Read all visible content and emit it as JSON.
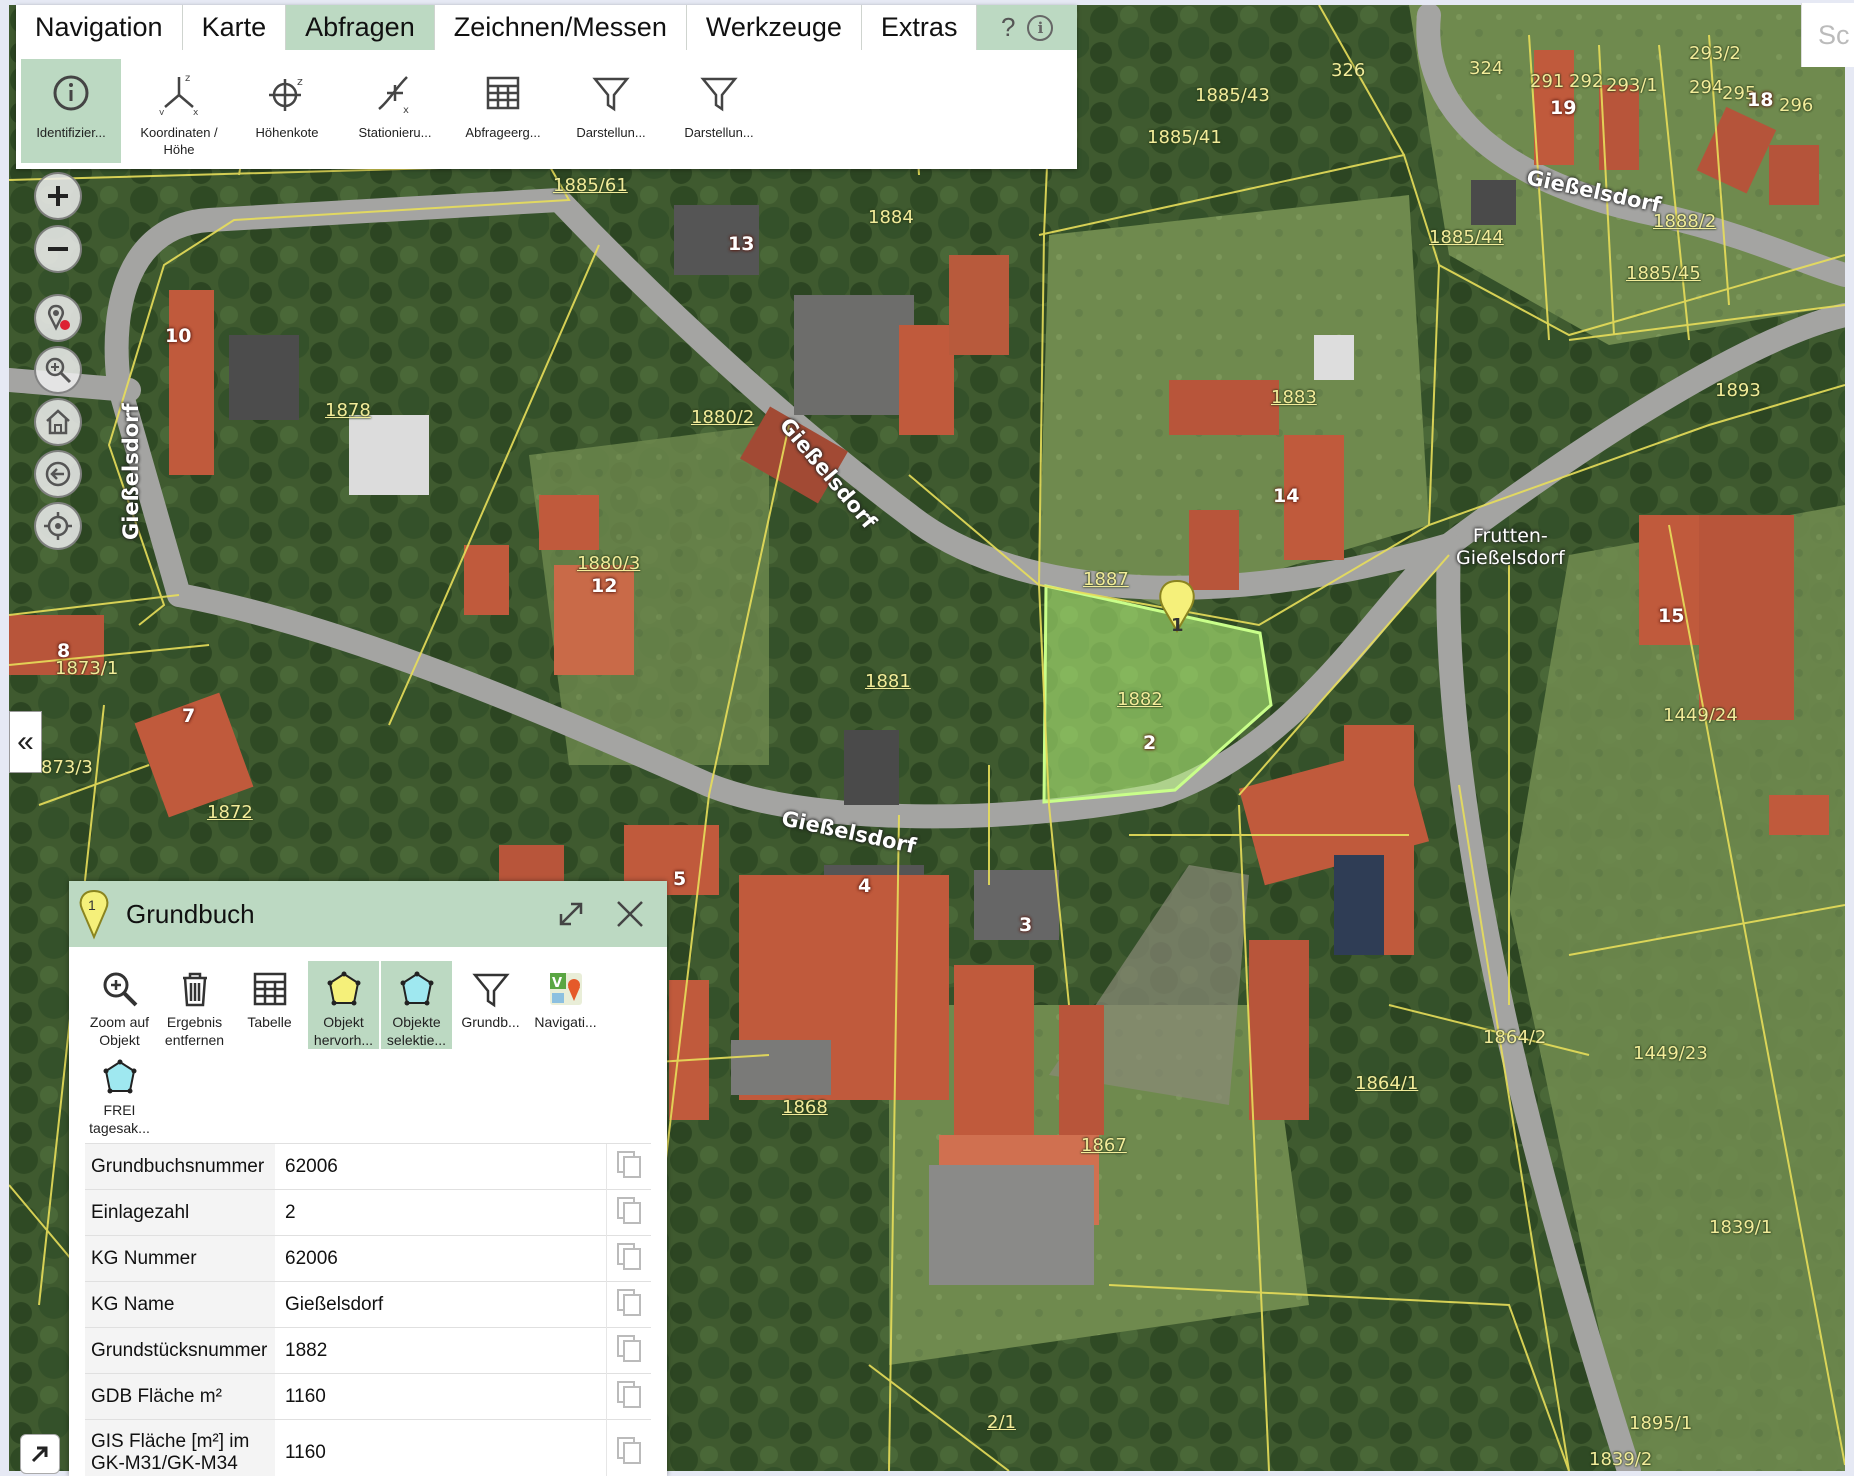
{
  "ribbon": {
    "tabs": [
      {
        "label": "Navigation",
        "active": false
      },
      {
        "label": "Karte",
        "active": false
      },
      {
        "label": "Abfragen",
        "active": true
      },
      {
        "label": "Zeichnen/Messen",
        "active": false
      },
      {
        "label": "Werkzeuge",
        "active": false
      },
      {
        "label": "Extras",
        "active": false
      }
    ],
    "help_label": "?",
    "info_label": "i",
    "tools": [
      {
        "label": "Identifizier...",
        "icon": "info-icon",
        "active": true
      },
      {
        "label": "Koordinaten / Höhe",
        "icon": "axes-icon",
        "active": false
      },
      {
        "label": "Höhenkote",
        "icon": "crosshair-z-icon",
        "active": false
      },
      {
        "label": "Stationieru...",
        "icon": "station-icon",
        "active": false
      },
      {
        "label": "Abfrageerg...",
        "icon": "table-icon",
        "active": false
      },
      {
        "label": "Darstellun...",
        "icon": "filter-icon",
        "active": false
      },
      {
        "label": "Darstellun...",
        "icon": "filter-icon",
        "active": false
      }
    ]
  },
  "search_stub": "Sc",
  "collapse_label": "«",
  "map": {
    "parcel_labels": [
      "326",
      "324",
      "291",
      "292",
      "293/1",
      "293/2",
      "294",
      "295",
      "296",
      "18",
      "1885/43",
      "1885/41",
      "1885/61",
      "1884",
      "1885/44",
      "1888/2",
      "1885/45",
      "1883",
      "1893",
      "1880/2",
      "1878",
      "1880/3",
      "1887",
      "1882",
      "1881",
      "1873/1",
      "873/3",
      "1872",
      "1449/24",
      "1864/2",
      "1864/1",
      "1449/23",
      "1868",
      "1867",
      "1839/1",
      "2/1",
      "1895/1",
      "1839/2"
    ],
    "house_numbers": [
      "19",
      "13",
      "10",
      "14",
      "12",
      "15",
      "8",
      "7",
      "2",
      "4",
      "3",
      "5",
      "1"
    ],
    "street_labels": [
      "Gießelsdorf",
      "Gießelsdorf",
      "Gießelsdorf",
      "Gießelsdorf"
    ],
    "place_label": "Frutten-\nGießelsdorf",
    "marker_label": "1"
  },
  "panel": {
    "marker_label": "1",
    "title": "Grundbuch",
    "tools": [
      {
        "label": "Zoom auf Objekt",
        "icon": "zoom-object-icon",
        "active": false
      },
      {
        "label": "Ergebnis entfernen",
        "icon": "trash-icon",
        "active": false
      },
      {
        "label": "Tabelle",
        "icon": "table-icon",
        "active": false
      },
      {
        "label": "Objekt hervorh...",
        "icon": "polygon-yellow-icon",
        "active": true
      },
      {
        "label": "Objekte selektie...",
        "icon": "polygon-cyan-icon",
        "active": true
      },
      {
        "label": "Grundb...",
        "icon": "filter-icon",
        "active": false
      },
      {
        "label": "Navigati...",
        "icon": "navigation-app-icon",
        "active": false
      },
      {
        "label": "FREI tagesak...",
        "icon": "polygon-cyan-icon",
        "active": false
      }
    ],
    "rows": [
      {
        "key": "Grundbuchsnummer",
        "value": "62006"
      },
      {
        "key": "Einlagezahl",
        "value": "2"
      },
      {
        "key": "KG Nummer",
        "value": "62006"
      },
      {
        "key": "KG Name",
        "value": "Gießelsdorf"
      },
      {
        "key": "Grundstücksnummer",
        "value": "1882"
      },
      {
        "key": "GDB Fläche m²",
        "value": "1160"
      },
      {
        "key": "GIS Fläche [m²] im GK-M31/GK-M34",
        "value": "1160"
      }
    ]
  }
}
